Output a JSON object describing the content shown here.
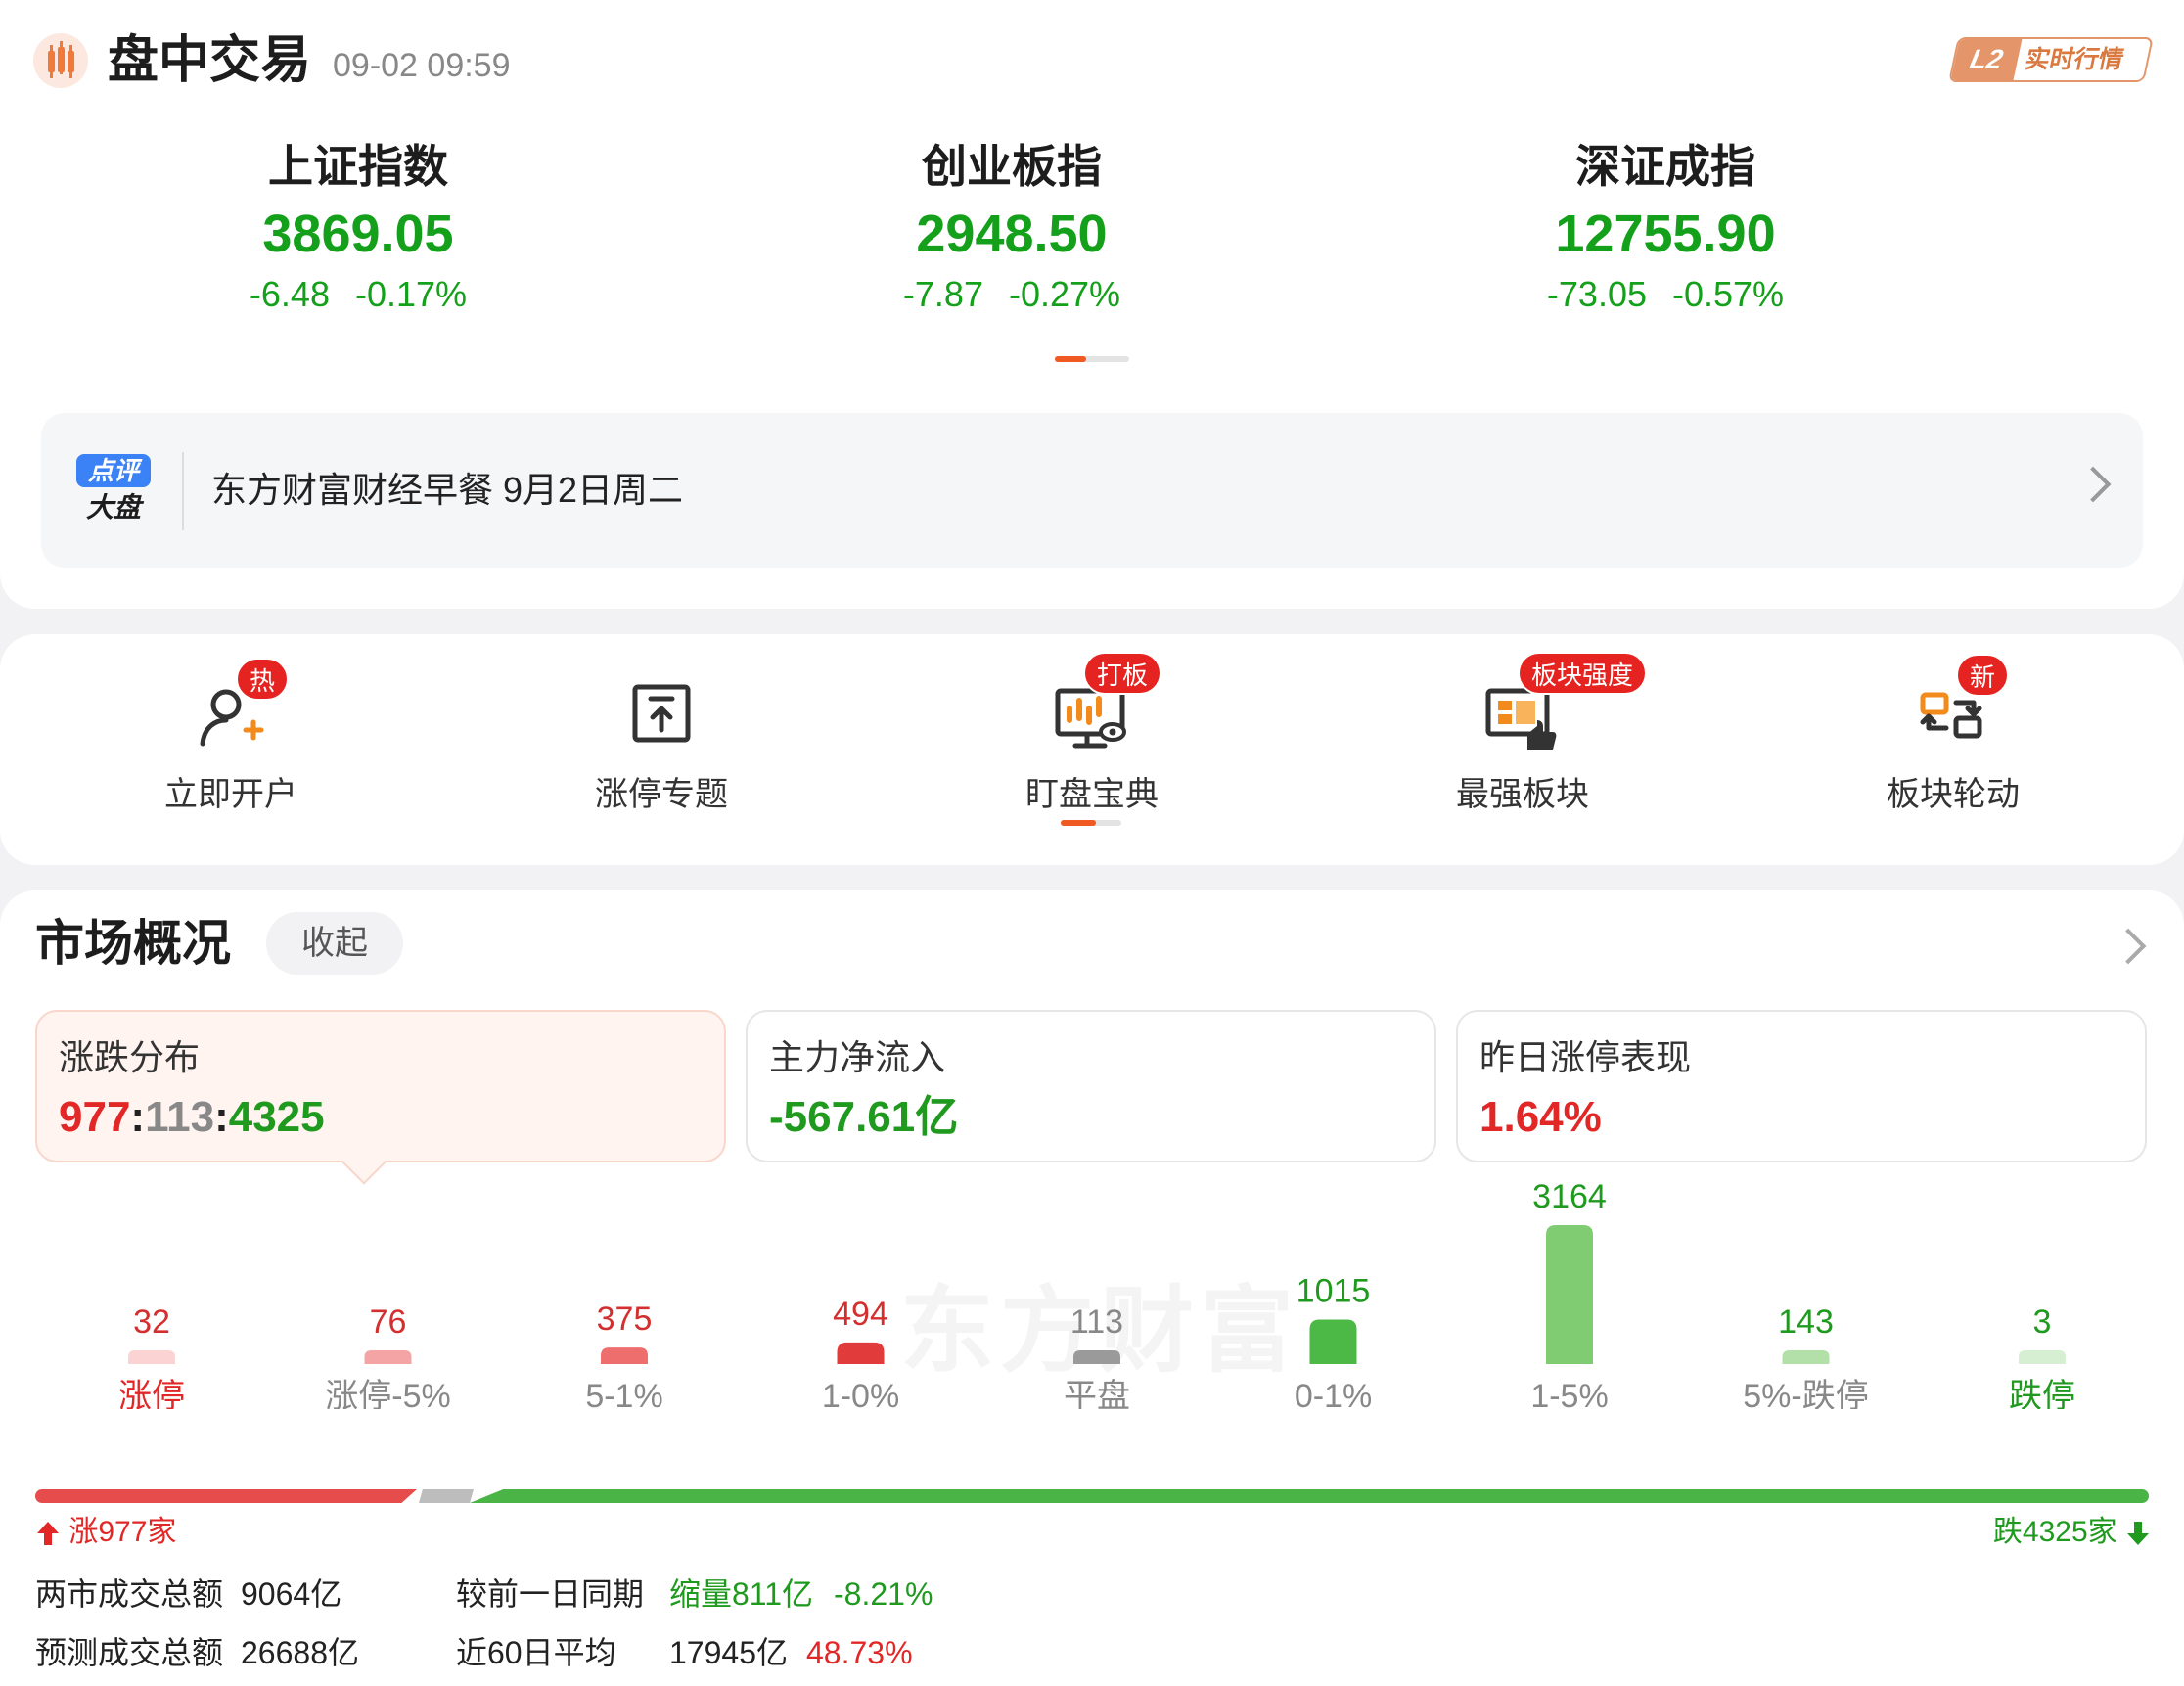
{
  "header": {
    "title": "盘中交易",
    "time": "09-02 09:59",
    "l2_badge": "L2",
    "l2_label": "实时行情"
  },
  "indices": [
    {
      "name": "上证指数",
      "value": "3869.05",
      "change": "-6.48",
      "pct": "-0.17%"
    },
    {
      "name": "创业板指",
      "value": "2948.50",
      "change": "-7.87",
      "pct": "-0.27%"
    },
    {
      "name": "深证成指",
      "value": "12755.90",
      "change": "-73.05",
      "pct": "-0.57%"
    }
  ],
  "news": {
    "badge_top": "点评",
    "badge_bottom": "大盘",
    "text": "东方财富财经早餐 9月2日周二"
  },
  "shortcuts": [
    {
      "label": "立即开户",
      "tag": "热",
      "icon": "user-add-icon"
    },
    {
      "label": "涨停专题",
      "tag": "",
      "icon": "upload-box-icon"
    },
    {
      "label": "盯盘宝典",
      "tag": "打板",
      "icon": "monitor-chart-icon"
    },
    {
      "label": "最强板块",
      "tag": "板块强度",
      "icon": "sector-strength-icon"
    },
    {
      "label": "板块轮动",
      "tag": "新",
      "icon": "rotation-icon"
    }
  ],
  "market": {
    "title": "市场概况",
    "toggle_label": "收起",
    "stats": [
      {
        "label": "涨跌分布",
        "up": "977",
        "flat": "113",
        "down": "4325",
        "sep": ":"
      },
      {
        "label": "主力净流入",
        "value": "-567.61亿"
      },
      {
        "label": "昨日涨停表现",
        "value": "1.64%"
      }
    ],
    "watermark": "东方财富",
    "up_count": "涨977家",
    "down_count": "跌4325家",
    "turnover": {
      "total_label": "两市成交总额",
      "total_value": "9064亿",
      "compare_label": "较前一日同期",
      "compare_value": "缩量811亿",
      "compare_pct": "-8.21%",
      "forecast_label": "预测成交总额",
      "forecast_value": "26688亿",
      "avg_label": "近60日平均",
      "avg_value": "17945亿",
      "avg_pct": "48.73%"
    }
  },
  "chart_data": {
    "type": "bar",
    "categories": [
      "涨停",
      "涨停-5%",
      "5-1%",
      "1-0%",
      "平盘",
      "0-1%",
      "1-5%",
      "5%-跌停",
      "跌停"
    ],
    "values": [
      32,
      76,
      375,
      494,
      113,
      1015,
      3164,
      143,
      3
    ],
    "colors": [
      "#fbd3d3",
      "#f4a4a4",
      "#ee6e6e",
      "#e23b3b",
      "#9a9a9a",
      "#4cb946",
      "#7fcc72",
      "#b2e0a8",
      "#d6eed1"
    ],
    "value_colors": [
      "#d32f2f",
      "#d32f2f",
      "#d32f2f",
      "#d32f2f",
      "#888888",
      "#1f9a1f",
      "#1f9a1f",
      "#1f9a1f",
      "#1f9a1f"
    ],
    "label_colors": [
      "#e22727",
      "#888888",
      "#888888",
      "#888888",
      "#888888",
      "#888888",
      "#888888",
      "#888888",
      "#1f9a1f"
    ]
  }
}
